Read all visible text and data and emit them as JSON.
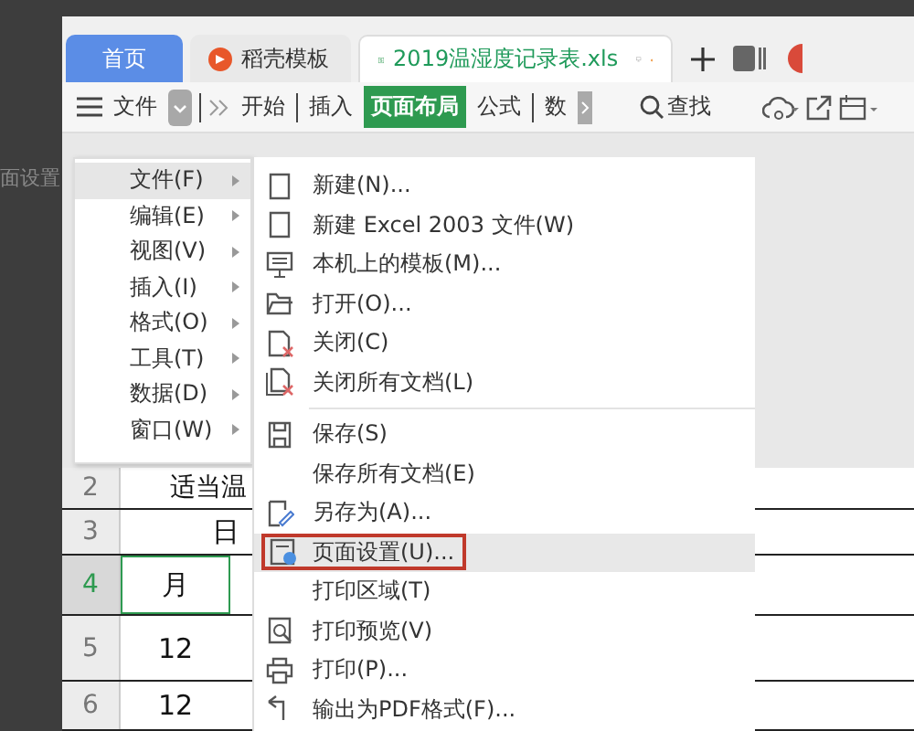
{
  "side_label": "面设置",
  "tabs": [
    {
      "kind": "home",
      "label": "首页",
      "selected": false
    },
    {
      "kind": "template",
      "label": "稻壳模板",
      "selected": false
    },
    {
      "kind": "document",
      "label": "2019温湿度记录表.xls",
      "selected": true
    }
  ],
  "toolbar": {
    "menu_label": "文件",
    "ribbon_tabs": [
      {
        "label": "开始",
        "selected": false
      },
      {
        "label": "插入",
        "selected": false
      },
      {
        "label": "页面布局",
        "selected": true
      },
      {
        "label": "公式",
        "selected": false
      },
      {
        "label": "数",
        "selected": false
      }
    ],
    "search_label": "查找"
  },
  "sheet": {
    "rows": [
      {
        "number": "2",
        "text": "适当温",
        "selected": false
      },
      {
        "number": "3",
        "text": "日",
        "selected": false
      },
      {
        "number": "4",
        "text": "月",
        "selected": true
      },
      {
        "number": "5",
        "text": "12",
        "selected": false
      },
      {
        "number": "6",
        "text": "12",
        "selected": false
      }
    ]
  },
  "menu": {
    "items": [
      {
        "label": "文件(F)",
        "selected": true
      },
      {
        "label": "编辑(E)",
        "selected": false
      },
      {
        "label": "视图(V)",
        "selected": false
      },
      {
        "label": "插入(I)",
        "selected": false
      },
      {
        "label": "格式(O)",
        "selected": false
      },
      {
        "label": "工具(T)",
        "selected": false
      },
      {
        "label": "数据(D)",
        "selected": false
      },
      {
        "label": "窗口(W)",
        "selected": false
      }
    ]
  },
  "submenu": {
    "items": [
      {
        "kind": "new",
        "label": "新建(N)...",
        "selected": false
      },
      {
        "kind": "new",
        "label": "新建 Excel 2003 文件(W)",
        "selected": false
      },
      {
        "kind": "template",
        "label": "本机上的模板(M)...",
        "selected": false
      },
      {
        "kind": "open",
        "label": "打开(O)...",
        "selected": false
      },
      {
        "kind": "close",
        "label": "关闭(C)",
        "selected": false
      },
      {
        "kind": "close-all",
        "label": "关闭所有文档(L)",
        "selected": false
      },
      {
        "kind": "save",
        "label": "保存(S)",
        "selected": false,
        "separator_before": true
      },
      {
        "kind": "plain",
        "label": "保存所有文档(E)",
        "selected": false
      },
      {
        "kind": "save-as",
        "label": "另存为(A)...",
        "selected": false
      },
      {
        "kind": "page-setup",
        "label": "页面设置(U)...",
        "selected": true
      },
      {
        "kind": "plain",
        "label": "打印区域(T)",
        "selected": false
      },
      {
        "kind": "print-preview",
        "label": "打印预览(V)",
        "selected": false
      },
      {
        "kind": "print",
        "label": "打印(P)...",
        "selected": false
      },
      {
        "kind": "export",
        "label": "输出为PDF格式(F)...",
        "selected": false
      }
    ]
  }
}
